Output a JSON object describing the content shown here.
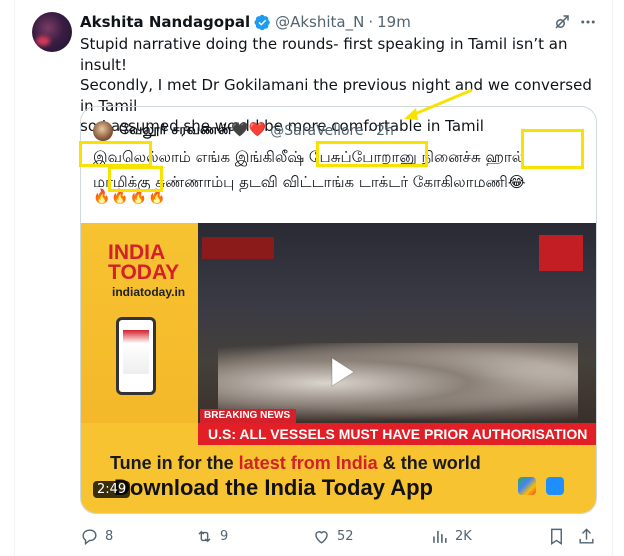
{
  "tweet": {
    "author_name": "Akshita Nandagopal",
    "author_handle": "@Akshita_N",
    "separator": "·",
    "time": "19m",
    "text_line1": "Stupid narrative doing the rounds- first speaking in Tamil isn’t an insult!",
    "text_line2": "Secondly, I met Dr Gokilamani the previous night and we conversed in Tamil",
    "text_line3": "so I assumed she would be more comfortable in Tamil"
  },
  "quoted": {
    "author_name": "வேலூர் சரவணன்🖤❤️",
    "author_handle": "@SaraVellore",
    "separator": "·",
    "time": "2h",
    "text_line1": "இவலெல்லாம் எங்க இங்கிலீஷ் பேசுப்போறானு நினைச்சு ஹால்",
    "text_line2": "மாமிக்கு சுண்ணாம்பு தடவி விட்டாங்க டாக்டர் கோகிலாமணி😂",
    "emoji_line": "🔥🔥🔥🔥",
    "media": {
      "logo_line1": "INDIA",
      "logo_line2": "TODAY",
      "url": "indiatoday.in",
      "breaking": "BREAKING NEWS",
      "headline": "U.S: ALL VESSELS MUST HAVE PRIOR AUTHORISATION",
      "tune_prefix": "Tune in for the",
      "tune_latest": "latest from India",
      "tune_suffix": "& the world",
      "download": "Download the India Today App",
      "duration": "2:49"
    }
  },
  "actions": {
    "replies": "8",
    "retweets": "9",
    "likes": "52",
    "views": "2K"
  },
  "colors": {
    "verified": "#1d9bf0",
    "highlight": "#f7e200",
    "muted": "#536471",
    "border": "#cfd9de",
    "media_bg": "#f7c331",
    "brand_red": "#d3202a"
  }
}
